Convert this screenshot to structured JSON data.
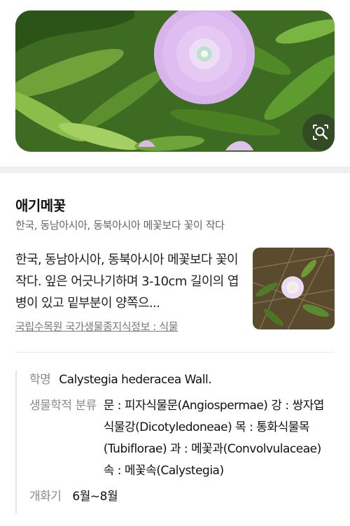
{
  "hero": {
    "image_alt": "pink bindweed flower among green leaves",
    "lens_icon": "image-search-icon"
  },
  "plant": {
    "name": "애기메꽃",
    "summary": "한국, 동남아시아, 동북아시아 메꽃보다 꽃이 작다",
    "description": "한국, 동남아시아, 동북아시아 메꽃보다 꽃이 작다. 잎은 어긋나기하며 3-10cm 길이의 엽병이 있고 밑부분이 양쪽으...",
    "source": "국립수목원 국가생물종지식정보 : 식물"
  },
  "info": {
    "scientific_label": "학명",
    "scientific_value": "Calystegia hederacea Wall.",
    "taxonomy_label": "생물학적 분류",
    "taxonomy_value": "문 : 피자식물문(Angiospermae) 강 : 쌍자엽식물강(Dicotyledoneae) 목 : 통화식물목(Tubiflorae) 과 : 메꽃과(Convolvulaceae) 속 : 메꽃속(Calystegia)",
    "bloom_label": "개화기",
    "bloom_value": "6월~8월"
  }
}
